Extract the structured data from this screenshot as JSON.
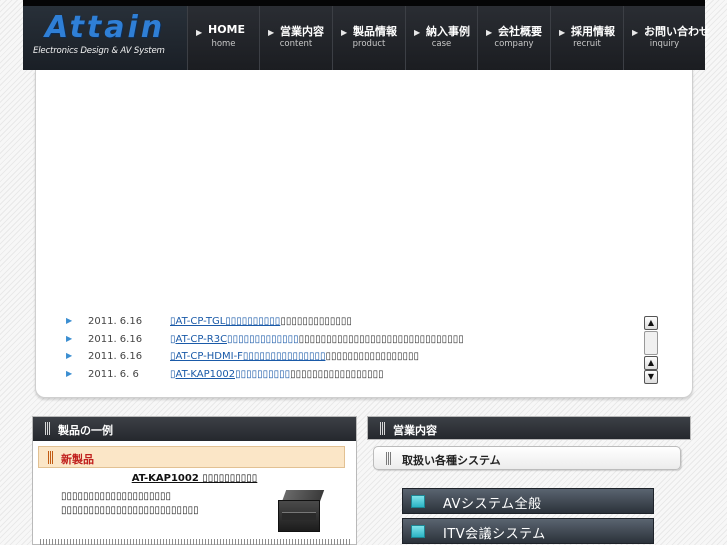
{
  "header": {
    "brand": "Attain",
    "tagline": "Electronics Design & AV System",
    "nav": [
      {
        "jp": "HOME",
        "en": "home"
      },
      {
        "jp": "営業内容",
        "en": "content"
      },
      {
        "jp": "製品情報",
        "en": "product"
      },
      {
        "jp": "納入事例",
        "en": "case"
      },
      {
        "jp": "会社概要",
        "en": "company"
      },
      {
        "jp": "採用情報",
        "en": "recruit"
      },
      {
        "jp": "お問い合わせ",
        "en": "inquiry"
      }
    ]
  },
  "news": {
    "items": [
      {
        "date": "2011. 6.16",
        "link": "▯AT-CP-TGL▯▯▯▯▯▯▯▯▯▯",
        "desc": "▯▯▯▯▯▯▯▯▯▯▯▯▯"
      },
      {
        "date": "2011. 6.16",
        "link": "▯AT-CP-R3C▯▯▯▯▯▯▯▯▯▯▯▯▯",
        "desc": "▯▯▯▯▯▯▯▯▯▯▯▯▯▯▯▯▯▯▯▯▯▯▯▯▯▯▯▯▯▯"
      },
      {
        "date": "2011. 6.16",
        "link": "▯AT-CP-HDMI-F▯▯▯▯▯▯▯▯▯▯▯▯▯▯▯",
        "desc": "▯▯▯▯▯▯▯▯▯▯▯▯▯▯▯▯▯"
      },
      {
        "date": "2011. 6. 6",
        "link": "▯AT-KAP1002▯▯▯▯▯▯▯▯▯▯",
        "desc": "▯▯▯▯▯▯▯▯▯▯▯▯▯▯▯▯▯"
      }
    ]
  },
  "products": {
    "heading": "製品の一例",
    "new_label": "新製品",
    "product_name": "AT-KAP1002 ▯▯▯▯▯▯▯▯▯▯",
    "desc_lines": [
      "▯▯▯▯▯▯▯▯▯▯▯▯▯▯▯▯▯▯▯▯",
      "▯▯▯▯▯▯▯▯▯▯▯▯▯▯▯▯▯▯▯▯▯▯▯▯▯"
    ]
  },
  "services": {
    "heading": "営業内容",
    "subheading": "取扱い各種システム",
    "buttons": [
      {
        "label": "AVシステム全般"
      },
      {
        "label": "ITV会議システム"
      }
    ]
  },
  "icons": {
    "nav_arrow": "play-arrow-icon",
    "news_bullet": "triangle-bullet-icon",
    "scroll_up": "scroll-up-arrow-icon",
    "scroll_down": "scroll-down-arrow-icon"
  },
  "colors": {
    "header_bg": "#1b1d21",
    "brand_blue": "#2f7fd6",
    "link_blue": "#1a5aa8",
    "new_red": "#c0201e",
    "new_box_bg": "#fbe6c7",
    "cyan_square": "#2bb3c4"
  }
}
